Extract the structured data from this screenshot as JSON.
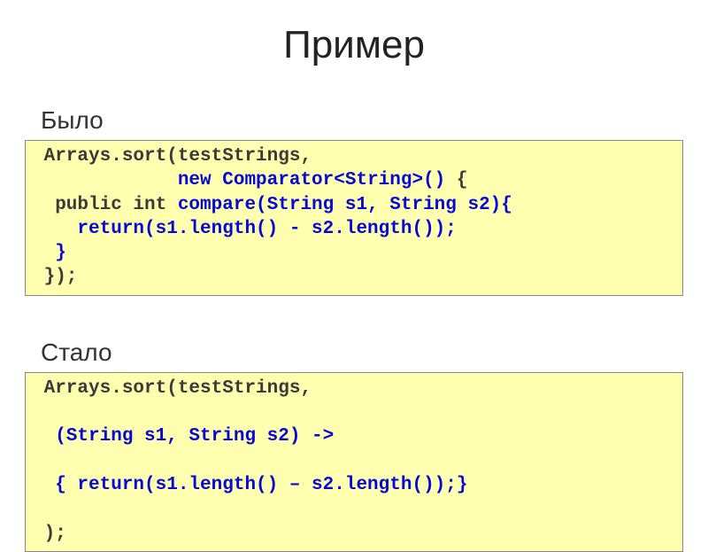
{
  "title": "Пример",
  "section1": {
    "label": "Было",
    "code": {
      "l1a": " Arrays.sort(testStrings,",
      "l2a": "             ",
      "l2b": "new Comparator<String>() ",
      "l2c": "{",
      "l3a": "  public int ",
      "l3b": "compare(String s1, String s2){",
      "l4": "    return(s1.length() - s2.length());",
      "l5": "  }",
      "l6": " });"
    }
  },
  "section2": {
    "label": "Стало",
    "code": {
      "l1": " Arrays.sort(testStrings,",
      "l2": "  (String s1, String s2) ->",
      "l3": "  { return(s1.length() – s2.length());}",
      "l4": " );"
    }
  }
}
